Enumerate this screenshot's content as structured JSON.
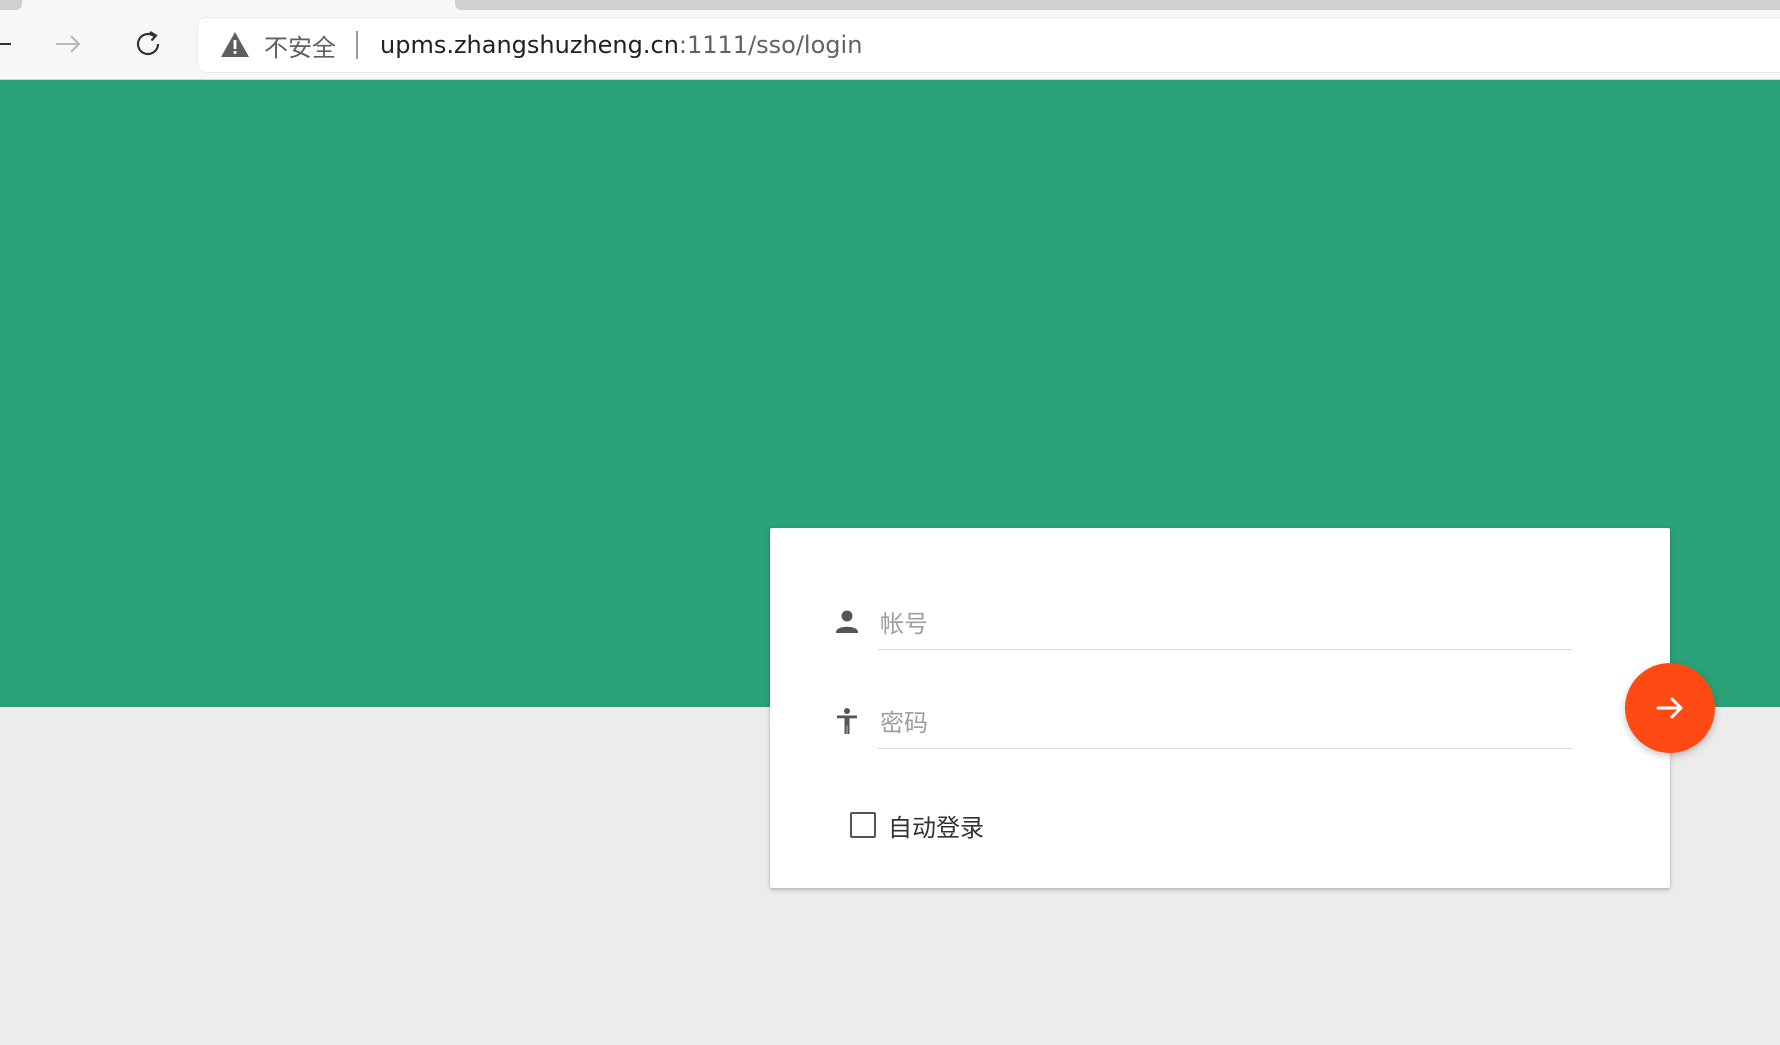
{
  "browser": {
    "security_label": "不安全",
    "url_host": "upms.zhangshuzheng.cn",
    "url_path": ":1111/sso/login"
  },
  "login_form": {
    "username_placeholder": "帐号",
    "password_placeholder": "密码",
    "remember_label": "自动登录",
    "remember_checked": false
  },
  "icons": {
    "back": "arrow-left-icon",
    "forward": "arrow-right-icon",
    "reload": "reload-icon",
    "security": "warning-triangle-icon",
    "username": "person-icon",
    "password": "accessibility-icon",
    "submit": "arrow-right-icon"
  },
  "colors": {
    "hero": "#29a277",
    "submit": "#ff4b13",
    "page_bg": "#ececec"
  }
}
